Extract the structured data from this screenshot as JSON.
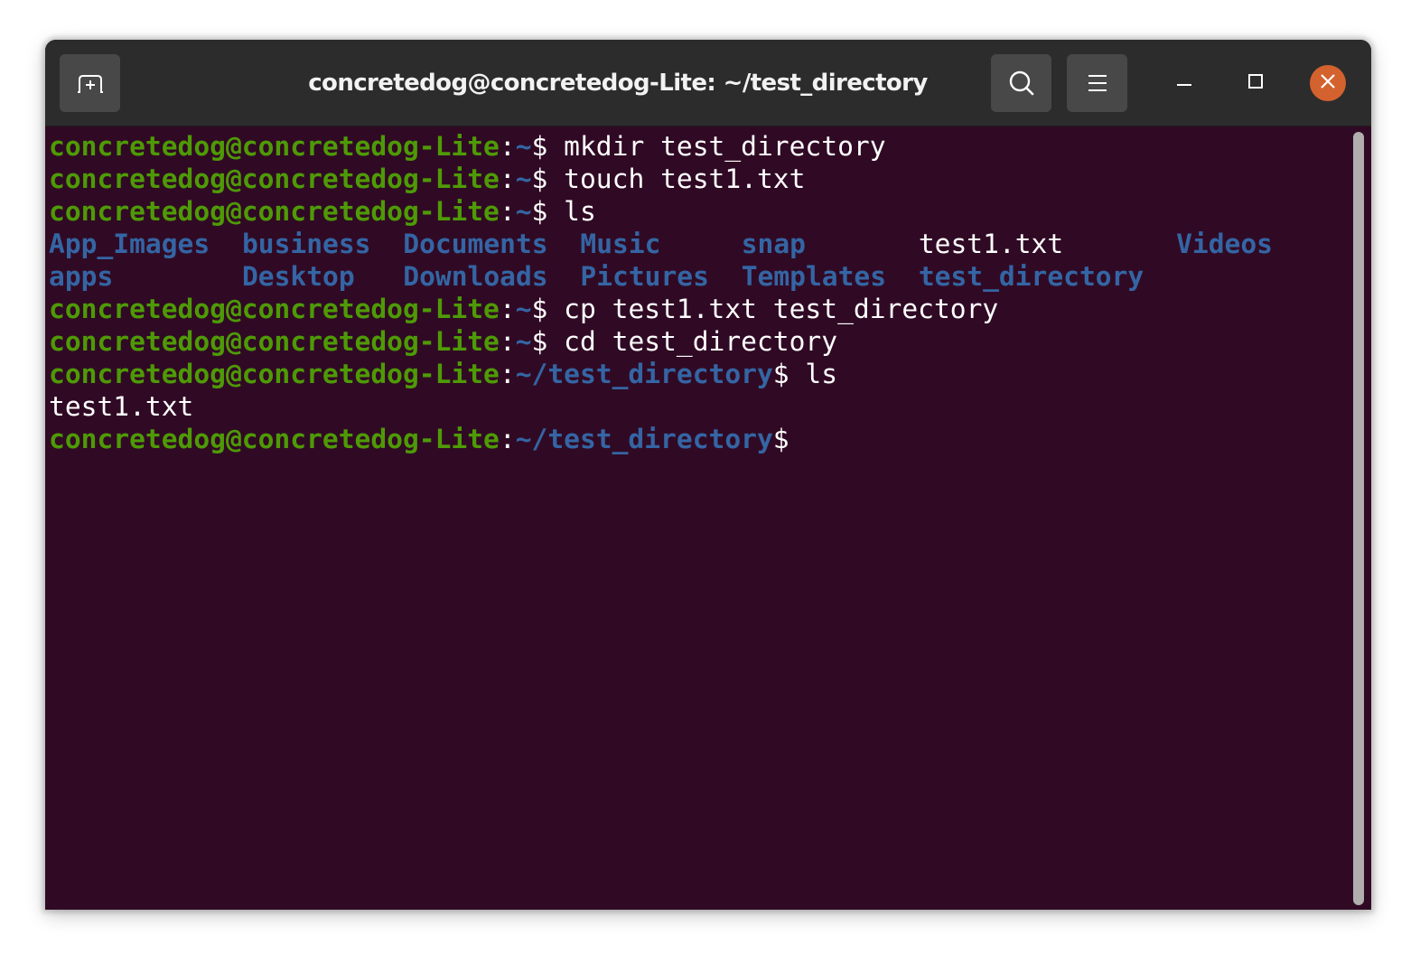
{
  "window": {
    "title": "concretedog@concretedog-Lite: ~/test_directory",
    "colors": {
      "background": "#300a24",
      "titlebar": "#2c2c2c",
      "prompt_user": "#4e9a06",
      "prompt_path": "#3465a4",
      "directory": "#3465a4",
      "text": "#ffffff",
      "close_button": "#d4622e"
    }
  },
  "titlebar": {
    "new_tab_icon": "new-tab-icon",
    "search_icon": "search-icon",
    "menu_icon": "hamburger-menu-icon",
    "minimize_icon": "minimize-icon",
    "maximize_icon": "maximize-icon",
    "close_icon": "close-icon"
  },
  "terminal": {
    "lines": [
      {
        "type": "prompt",
        "user": "concretedog@concretedog-Lite",
        "sep": ":",
        "path": "~",
        "symbol": "$",
        "command": " mkdir test_directory"
      },
      {
        "type": "prompt",
        "user": "concretedog@concretedog-Lite",
        "sep": ":",
        "path": "~",
        "symbol": "$",
        "command": " touch test1.txt"
      },
      {
        "type": "prompt",
        "user": "concretedog@concretedog-Lite",
        "sep": ":",
        "path": "~",
        "symbol": "$",
        "command": " ls"
      },
      {
        "type": "ls",
        "items": [
          {
            "name": "App_Images",
            "kind": "dir"
          },
          {
            "name": "business",
            "kind": "dir"
          },
          {
            "name": "Documents",
            "kind": "dir"
          },
          {
            "name": "Music",
            "kind": "dir"
          },
          {
            "name": "snap",
            "kind": "dir"
          },
          {
            "name": "test1.txt",
            "kind": "file"
          },
          {
            "name": "Videos",
            "kind": "dir"
          },
          {
            "name": "apps",
            "kind": "dir"
          },
          {
            "name": "Desktop",
            "kind": "dir"
          },
          {
            "name": "Downloads",
            "kind": "dir"
          },
          {
            "name": "Pictures",
            "kind": "dir"
          },
          {
            "name": "Templates",
            "kind": "dir"
          },
          {
            "name": "test_directory",
            "kind": "dir"
          }
        ]
      },
      {
        "type": "prompt",
        "user": "concretedog@concretedog-Lite",
        "sep": ":",
        "path": "~",
        "symbol": "$",
        "command": " cp test1.txt test_directory"
      },
      {
        "type": "prompt",
        "user": "concretedog@concretedog-Lite",
        "sep": ":",
        "path": "~",
        "symbol": "$",
        "command": " cd test_directory"
      },
      {
        "type": "prompt",
        "user": "concretedog@concretedog-Lite",
        "sep": ":",
        "path": "~/test_directory",
        "symbol": "$",
        "command": " ls"
      },
      {
        "type": "output",
        "text": "test1.txt"
      },
      {
        "type": "prompt",
        "user": "concretedog@concretedog-Lite",
        "sep": ":",
        "path": "~/test_directory",
        "symbol": "$",
        "command": ""
      }
    ]
  }
}
